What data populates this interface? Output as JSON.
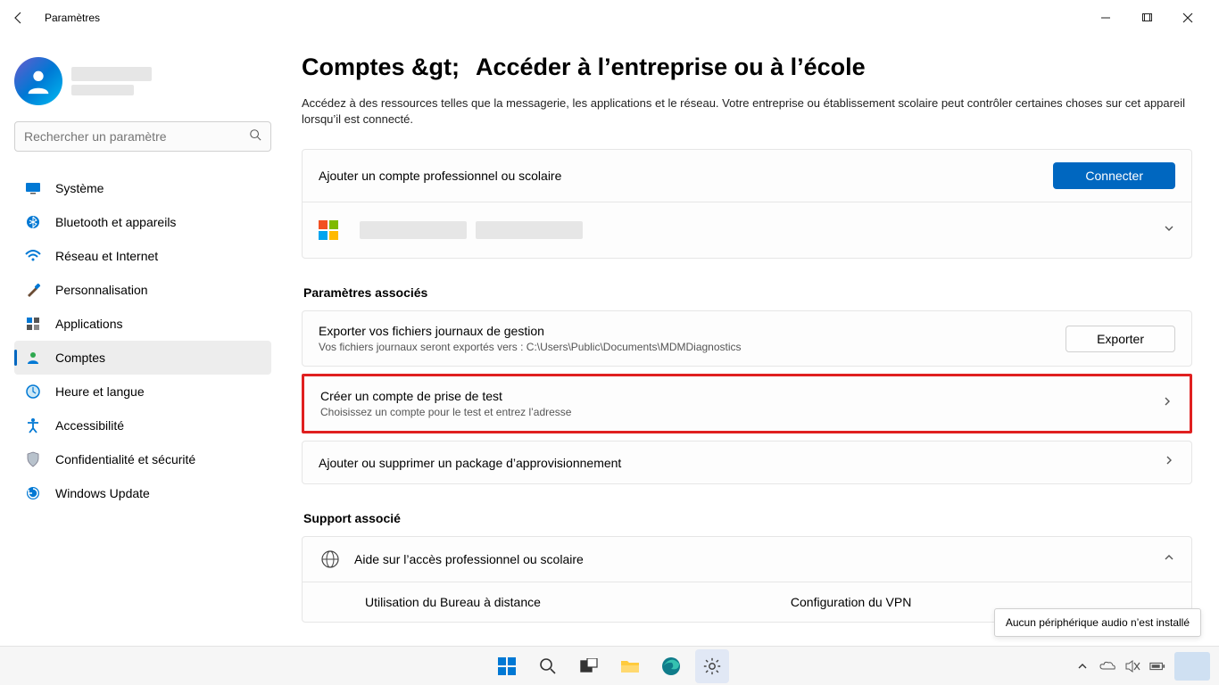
{
  "window": {
    "title": "Paramètres"
  },
  "profile": {
    "name_redacted": true
  },
  "search": {
    "placeholder": "Rechercher un paramètre"
  },
  "nav": {
    "system": "Système",
    "bluetooth": "Bluetooth et appareils",
    "network": "Réseau et Internet",
    "personalization": "Personnalisation",
    "apps": "Applications",
    "accounts": "Comptes",
    "time": "Heure et langue",
    "accessibility": "Accessibilité",
    "privacy": "Confidentialité et sécurité",
    "update": "Windows Update"
  },
  "main": {
    "breadcrumb_parent": "Comptes &gt;",
    "breadcrumb_current": "Accéder à l’entreprise ou à l’école",
    "description": "Accédez à des ressources telles que la messagerie, les applications et le réseau. Votre entreprise ou établissement scolaire peut contrôler certaines choses sur cet appareil lorsqu’il est connecté.",
    "add_account": {
      "label": "Ajouter un compte professionnel ou scolaire",
      "button": "Connecter"
    },
    "related_header": "Paramètres associés",
    "export": {
      "title": "Exporter vos fichiers journaux de gestion",
      "sub": "Vos fichiers journaux seront exportés vers : C:\\Users\\Public\\Documents\\MDMDiagnostics",
      "button": "Exporter"
    },
    "test_account": {
      "title": "Créer un compte de prise de test",
      "sub": "Choisissez un compte pour le test et entrez l’adresse"
    },
    "provisioning": {
      "title": "Ajouter ou supprimer un package d’approvisionnement"
    },
    "support_header": "Support associé",
    "help": {
      "title": "Aide sur l’accès professionnel ou scolaire",
      "link1": "Utilisation du Bureau à distance",
      "link2": "Configuration du VPN"
    }
  },
  "tooltip": "Aucun périphérique audio n’est installé"
}
